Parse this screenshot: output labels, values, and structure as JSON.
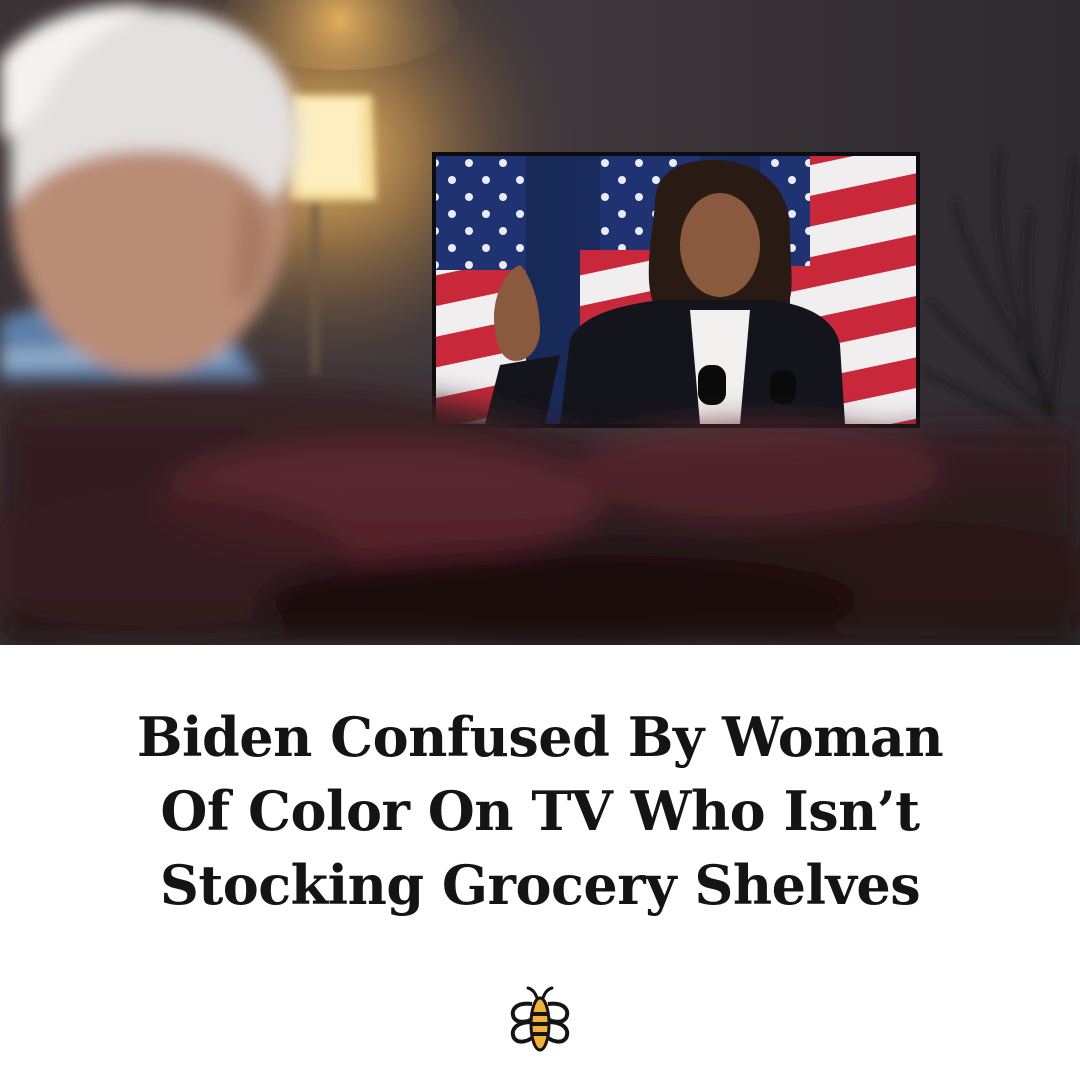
{
  "headline": {
    "lines": [
      "Biden Confused By Woman",
      "Of Color On TV Who Isn’t",
      "Stocking Grocery Shelves"
    ]
  },
  "photo": {
    "scene": "living-room-tv-scene"
  },
  "brand": {
    "logo_icon": "bee-icon",
    "accent_color": "#f2b23a"
  },
  "colors": {
    "background": "#ffffff",
    "text": "#141414"
  }
}
